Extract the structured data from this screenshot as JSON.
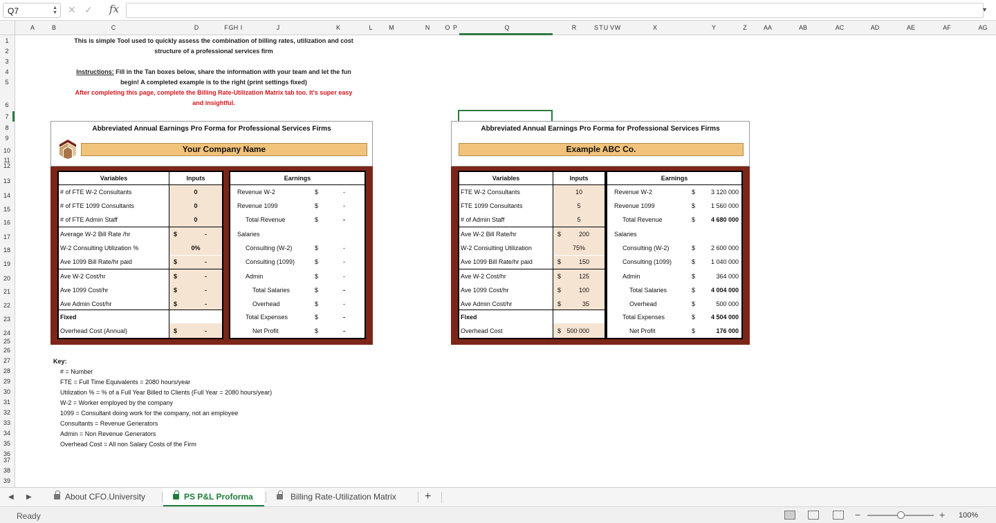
{
  "formula_bar": {
    "name_box": "Q7",
    "fx": "fx",
    "formula": ""
  },
  "columns": [
    "A",
    "B",
    "C",
    "D",
    "F",
    "G",
    "H",
    "I",
    "J",
    "K",
    "L",
    "M",
    "N",
    "O",
    "P",
    "Q",
    "R",
    "S",
    "T",
    "U",
    "V",
    "W",
    "X",
    "Y",
    "Z",
    "AA",
    "AB",
    "AC",
    "AD",
    "AE",
    "AF",
    "AG"
  ],
  "rows": [
    "1",
    "2",
    "3",
    "4",
    "5",
    "6",
    "7",
    "8",
    "9",
    "10",
    "11",
    "12",
    "13",
    "14",
    "15",
    "16",
    "17",
    "18",
    "19",
    "20",
    "21",
    "22",
    "23",
    "24",
    "25",
    "26",
    "27",
    "28",
    "29",
    "30",
    "31",
    "32",
    "33",
    "34",
    "35",
    "36",
    "37",
    "38",
    "39"
  ],
  "intro": {
    "line1": "This is simple Tool used to quickly assess the combination of billing rates, utilization and cost",
    "line2": "structure of a professional services firm",
    "instr_label": "Instructions:",
    "instr_text": " Fill in the Tan boxes below, share the information with your team  and let the fun",
    "line4": "begin!  A completed example is to the right (print  settings fixed)",
    "red1": "After completing this page, complete the Billing Rate-Utilization Matrix tab too.  It's super easy",
    "red2": "and insightful."
  },
  "left": {
    "title": "Abbreviated Annual Earnings Pro Forma for Professional Services Firms",
    "company": "Your Company Name",
    "var_header": "Variables",
    "inp_header": "Inputs",
    "earn_header": "Earnings",
    "variables": [
      "# of FTE W-2 Consultants",
      "# of FTE 1099 Consultants",
      "# of FTE Admin Staff",
      "Average  W-2 Bill Rate /hr",
      "W-2 Consulting Utilization %",
      "Ave 1099 Bill Rate/hr paid",
      "Ave W-2 Cost/hr",
      "Ave 1099 Cost/hr",
      "Ave Admin Cost/hr",
      "Fixed",
      "Overhead Cost (Annual)"
    ],
    "inputs": [
      {
        "dol": "",
        "val": "0",
        "bold": true
      },
      {
        "dol": "",
        "val": "0",
        "bold": true
      },
      {
        "dol": "",
        "val": "0",
        "bold": true
      },
      {
        "dol": "$",
        "val": "-",
        "bold": true
      },
      {
        "dol": "",
        "val": "0%",
        "bold": true
      },
      {
        "dol": "$",
        "val": "-",
        "bold": true
      },
      {
        "dol": "$",
        "val": "-",
        "bold": true
      },
      {
        "dol": "$",
        "val": "-",
        "bold": true
      },
      {
        "dol": "$",
        "val": "-",
        "bold": true
      },
      {
        "dol": "",
        "val": "",
        "bold": false
      },
      {
        "dol": "$",
        "val": "-",
        "bold": true
      }
    ],
    "earnings": [
      {
        "label": "Revenue  W-2",
        "dol": "$",
        "val": "-",
        "bold": false
      },
      {
        "label": "Revenue 1099",
        "dol": "$",
        "val": "-",
        "bold": false
      },
      {
        "label": "Total Revenue",
        "dol": "$",
        "val": "-",
        "bold": true
      },
      {
        "label": "Salaries",
        "dol": "",
        "val": "",
        "bold": false
      },
      {
        "label": "Consulting (W-2)",
        "dol": "$",
        "val": "-",
        "bold": false
      },
      {
        "label": "Consulting (1099)",
        "dol": "$",
        "val": "-",
        "bold": false
      },
      {
        "label": "Admin",
        "dol": "$",
        "val": "-",
        "bold": false
      },
      {
        "label": "Total Salaries",
        "dol": "$",
        "val": "-",
        "bold": true
      },
      {
        "label": "Overhead",
        "dol": "$",
        "val": "-",
        "bold": false
      },
      {
        "label": "Total Expenses",
        "dol": "$",
        "val": "-",
        "bold": true
      },
      {
        "label": "Net Profit",
        "dol": "$",
        "val": "-",
        "bold": true
      }
    ]
  },
  "right": {
    "title": "Abbreviated Annual Earnings Pro Forma for Professional Services Firms",
    "company": "Example  ABC Co.",
    "var_header": "Variables",
    "inp_header": "Inputs",
    "earn_header": "Earnings",
    "variables": [
      "FTE W-2 Consultants",
      "FTE 1099 Consultants",
      "# of Admin Staff",
      "Ave W-2 Bill Rate/hr",
      "W-2 Consulting Utilization",
      "Ave 1099 Bill Rate/hr paid",
      "Ave W-2 Cost/hr",
      "Ave 1099 Cost/hr",
      "Ave Admin Cost/hr",
      "Fixed",
      "Overhead Cost"
    ],
    "inputs": [
      {
        "dol": "",
        "val": "10",
        "bold": false
      },
      {
        "dol": "",
        "val": "5",
        "bold": false
      },
      {
        "dol": "",
        "val": "5",
        "bold": false
      },
      {
        "dol": "$",
        "val": "200",
        "bold": false
      },
      {
        "dol": "",
        "val": "75%",
        "bold": false
      },
      {
        "dol": "$",
        "val": "150",
        "bold": false
      },
      {
        "dol": "$",
        "val": "125",
        "bold": false
      },
      {
        "dol": "$",
        "val": "100",
        "bold": false
      },
      {
        "dol": "$",
        "val": "35",
        "bold": false
      },
      {
        "dol": "",
        "val": "",
        "bold": false
      },
      {
        "dol": "$",
        "val": "500 000",
        "bold": false
      }
    ],
    "earnings": [
      {
        "label": "Revenue  W-2",
        "dol": "$",
        "val": "3 120 000",
        "bold": false
      },
      {
        "label": "Revenue 1099",
        "dol": "$",
        "val": "1 560 000",
        "bold": false
      },
      {
        "label": "Total Revenue",
        "dol": "$",
        "val": "4 680 000",
        "bold": true
      },
      {
        "label": "Salaries",
        "dol": "",
        "val": "",
        "bold": false
      },
      {
        "label": "Consulting (W-2)",
        "dol": "$",
        "val": "2 600 000",
        "bold": false
      },
      {
        "label": "Consulting (1099)",
        "dol": "$",
        "val": "1 040 000",
        "bold": false
      },
      {
        "label": "Admin",
        "dol": "$",
        "val": "364 000",
        "bold": false
      },
      {
        "label": "Total Salaries",
        "dol": "$",
        "val": "4 004 000",
        "bold": true
      },
      {
        "label": "Overhead",
        "dol": "$",
        "val": "500 000",
        "bold": false
      },
      {
        "label": "Total Expenses",
        "dol": "$",
        "val": "4 504 000",
        "bold": true
      },
      {
        "label": "Net Profit",
        "dol": "$",
        "val": "176 000",
        "bold": true
      }
    ]
  },
  "key": {
    "title": "Key:",
    "items": [
      "# = Number",
      "FTE = Full Time Equivalents = 2080 hours/year",
      "Utilization % = % of a Full Year Billed to Clients (Full Year = 2080 hours/year)",
      "W-2 = Worker employed by the company",
      "1099 = Consultant doing work for the company, not an employee",
      "Consultants = Revenue Generators",
      "Admin = Non Revenue Generators",
      "Overhead Cost = All non Salary Costs of the Firm"
    ]
  },
  "tabs": [
    "About CFO.University",
    "PS P&L Proforma",
    "Billing Rate-Utilization Matrix"
  ],
  "status": {
    "ready": "Ready",
    "zoom": "100%"
  },
  "colors": {
    "accent": "#1e7c3a",
    "tan": "#f1c27a",
    "maroon": "#7b2618",
    "red": "#d4161c"
  }
}
